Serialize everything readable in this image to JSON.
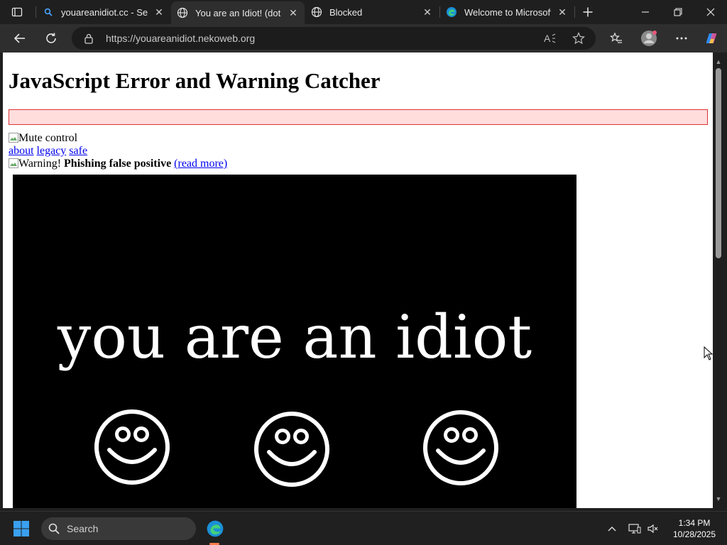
{
  "tabs": [
    {
      "title": "youareanidiot.cc - Search",
      "icon": "search-icon",
      "active": false
    },
    {
      "title": "You are an Idiot! (dot cc)",
      "icon": "globe-icon",
      "active": true
    },
    {
      "title": "Blocked",
      "icon": "globe-icon",
      "active": false
    },
    {
      "title": "Welcome to Microsoft Edge",
      "icon": "edge-icon",
      "active": false
    }
  ],
  "toolbar": {
    "url": "https://youareanidiot.nekoweb.org"
  },
  "page": {
    "heading": "JavaScript Error and Warning Catcher",
    "mute_alt": "Mute control",
    "links": [
      "about",
      "legacy",
      "safe"
    ],
    "warning_alt": "Warning!",
    "warning_bold": "Phishing false positive",
    "read_more": "(read more)",
    "video_text": "you are an idiot"
  },
  "taskbar": {
    "search_label": "Search",
    "time": "1:34 PM",
    "date": "10/28/2025"
  },
  "colors": {
    "tabstrip": "#1f1f1f",
    "active_tab": "#2e2e2e",
    "error_box_bg": "#ffdddd",
    "error_box_border": "#dd3333",
    "link": "#0000ee"
  }
}
